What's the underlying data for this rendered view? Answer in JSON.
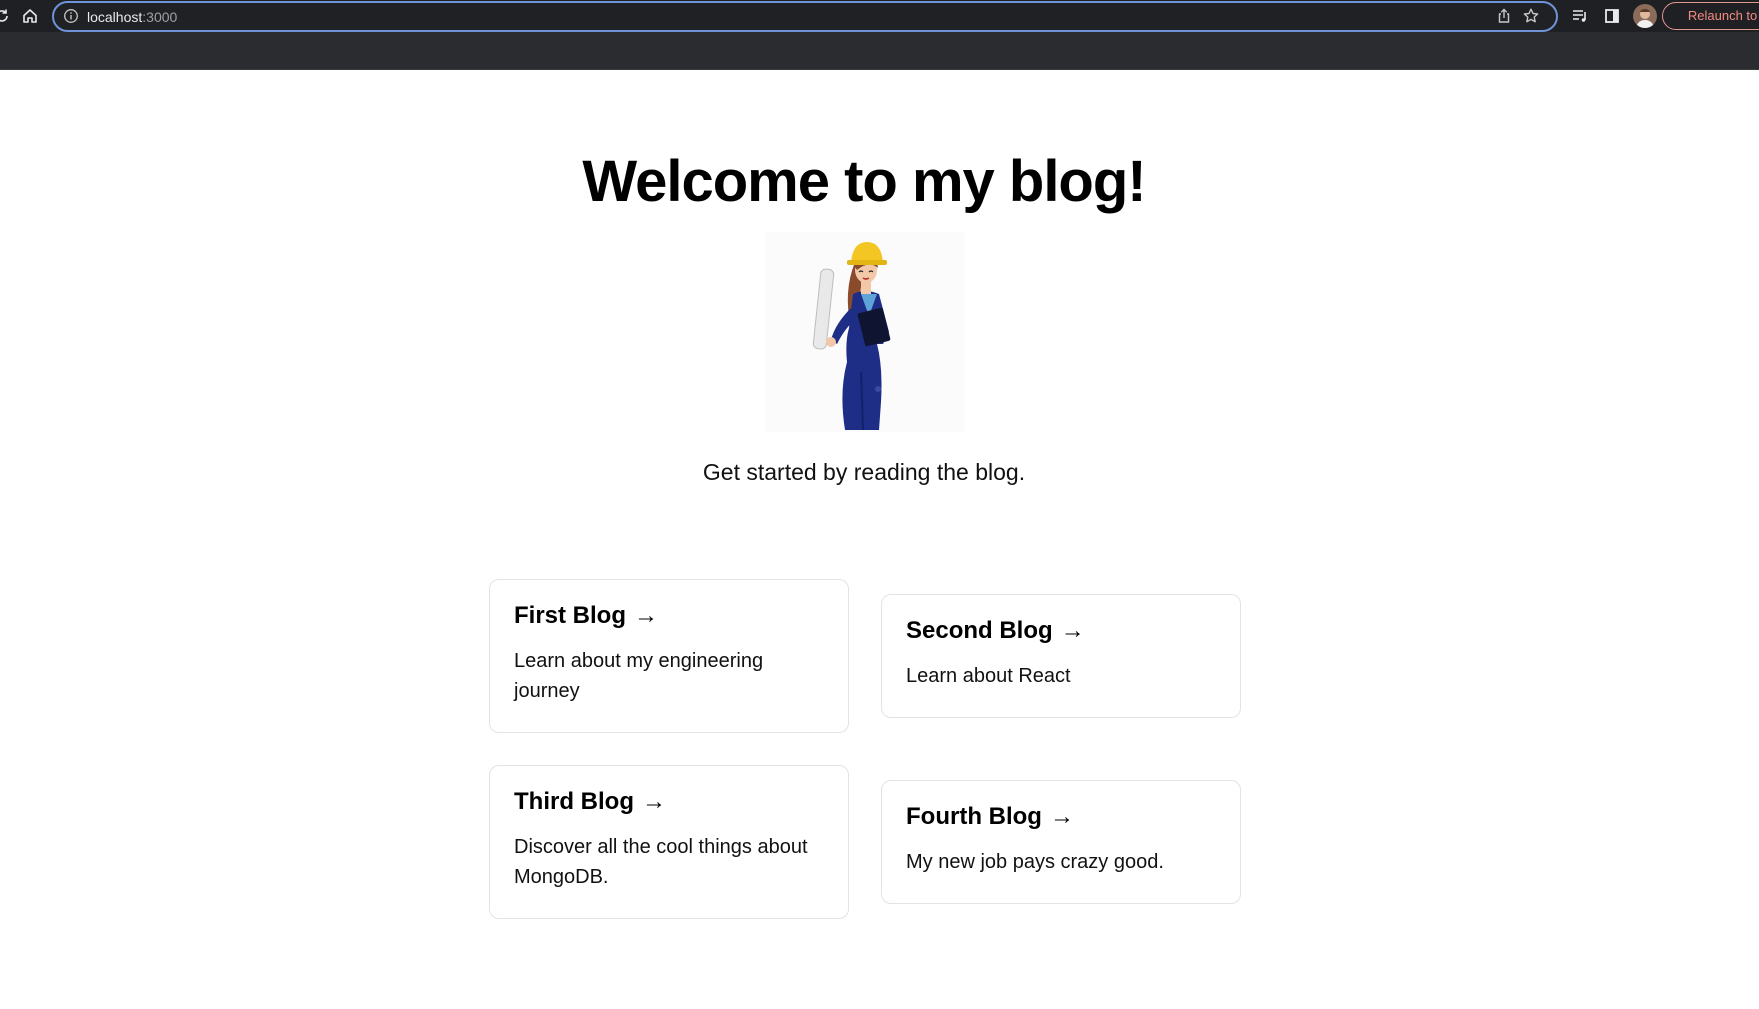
{
  "browser": {
    "url_host": "localhost",
    "url_port": ":3000",
    "relaunch_label": "Relaunch to u"
  },
  "page": {
    "title": "Welcome to my blog!",
    "subtitle": "Get started by reading the blog."
  },
  "cards": [
    {
      "title": "First Blog",
      "arrow": "→",
      "description": "Learn about my engineering journey"
    },
    {
      "title": "Second Blog",
      "arrow": "→",
      "description": "Learn about React"
    },
    {
      "title": "Third Blog",
      "arrow": "→",
      "description": "Discover all the cool things about MongoDB."
    },
    {
      "title": "Fourth Blog",
      "arrow": "→",
      "description": "My new job pays crazy good."
    }
  ],
  "colors": {
    "toolbar_bg": "#1f2023",
    "omnibox_border": "#6f93d6",
    "relaunch": "#f28b82",
    "card_border": "#e3e3e3"
  },
  "icons": [
    "reload-icon",
    "home-icon",
    "info-icon",
    "share-icon",
    "star-icon",
    "media-icon",
    "side-panel-icon",
    "avatar"
  ]
}
